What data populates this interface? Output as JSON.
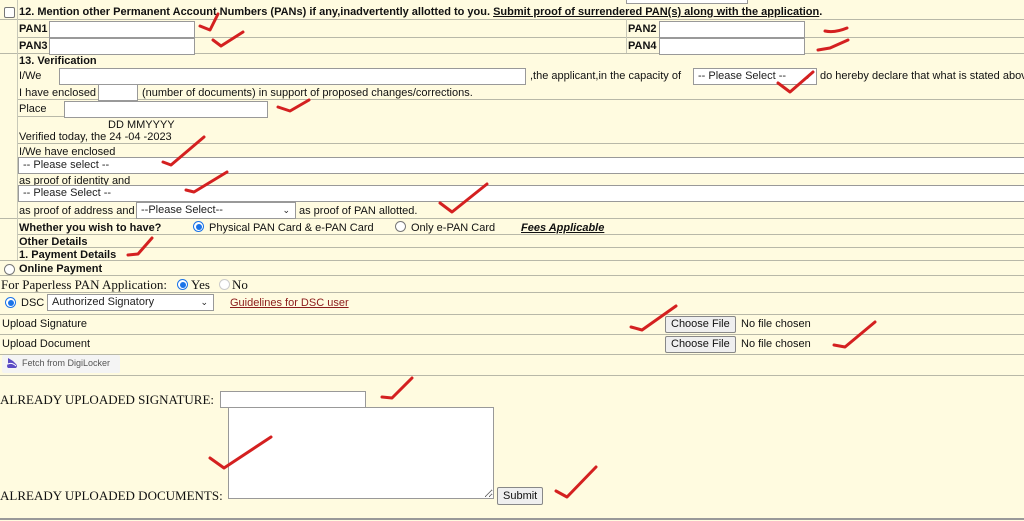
{
  "section12": {
    "title": "12. Mention other Permanent Account Numbers (PANs) if any,inadvertently allotted to you.",
    "proof_link": "Submit proof of surrendered PAN(s) along with the application",
    "trailing": ".",
    "pan1_label": "PAN1",
    "pan2_label": "PAN2",
    "pan3_label": "PAN3",
    "pan4_label": "PAN4",
    "pan1_value": "",
    "pan2_value": "",
    "pan3_value": "",
    "pan4_value": ""
  },
  "section13": {
    "title": "13. Verification",
    "iwe_label": "I/We",
    "iwe_value": "",
    "applicant_text": ",the applicant,in the capacity of",
    "capacity_select": "-- Please Select --",
    "declare_text": "do hereby declare that what is stated abov",
    "enclosed_label": "I have enclosed",
    "enclosed_value": "",
    "enclosed_suffix": "(number of documents) in support of proposed changes/corrections.",
    "place_label": "Place",
    "place_value": "",
    "date_format": "DD MMYYYY",
    "verified_text": "Verified today, the 24 -04 -2023",
    "we_have_enclosed": "I/We have enclosed",
    "identity_select": "-- Please select --",
    "identity_suffix": "as proof of identity and",
    "address_select": "-- Please Select --",
    "address_prefix": "as proof of address and",
    "pan_proof_select": "--Please Select--",
    "pan_proof_suffix": "as proof of PAN allotted."
  },
  "card_choice": {
    "question": "Whether you wish to have?",
    "option_physical": "Physical PAN Card & e-PAN Card",
    "option_epan": "Only e-PAN Card",
    "selected": "physical",
    "fees_link": "Fees Applicable"
  },
  "other_details": {
    "title": "Other Details",
    "payment_title": "1. Payment Details",
    "online_payment": "Online Payment"
  },
  "paperless": {
    "label": "For Paperless PAN Application:",
    "yes": "Yes",
    "no": "No",
    "selected": "yes"
  },
  "dsc": {
    "label": "DSC",
    "select_value": "Authorized Signatory",
    "guidelines_link": "Guidelines for DSC user"
  },
  "uploads": {
    "signature_label": "Upload Signature",
    "document_label": "Upload Document",
    "choose_file": "Choose File",
    "no_file": "No file chosen",
    "digilocker": "Fetch from DigiLocker"
  },
  "already": {
    "signature_label": "ALREADY UPLOADED SIGNATURE:",
    "signature_value": "",
    "documents_label": "ALREADY UPLOADED DOCUMENTS:",
    "documents_value": "",
    "submit": "Submit"
  },
  "colors": {
    "background": "#fffbe0",
    "link_maroon": "#8b1a1a",
    "radio_blue": "#1a73e8",
    "annotation_red": "#d42020"
  }
}
